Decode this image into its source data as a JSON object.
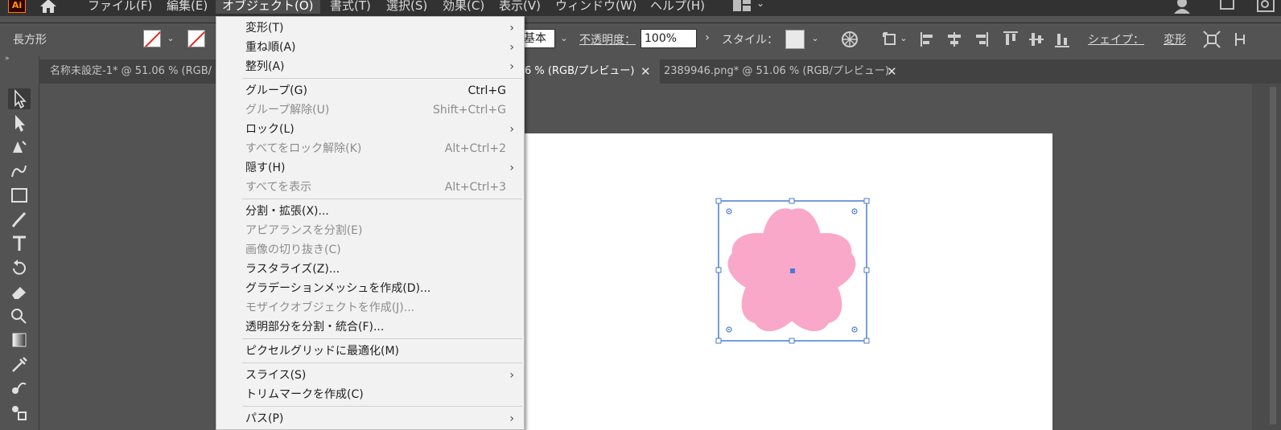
{
  "app": {
    "logo": "Ai"
  },
  "menubar": {
    "items": [
      "ファイル(F)",
      "編集(E)",
      "オブジェクト(O)",
      "書式(T)",
      "選択(S)",
      "効果(C)",
      "表示(V)",
      "ウィンドウ(W)",
      "ヘルプ(H)"
    ],
    "active_index": 2
  },
  "control_bar": {
    "tool_label": "長方形",
    "stroke_style": "基本",
    "opacity_label": "不透明度：",
    "opacity_value": "100%",
    "style_label": "スタイル：",
    "shape_label": "シェイプ：",
    "transform_label": "変形"
  },
  "tabs": [
    {
      "label": "名称未設定-1* @ 51.06 % (RGB/",
      "closable": false
    },
    {
      "label": "6 % (RGB/プレビュー)",
      "closable": true,
      "active": true
    },
    {
      "label": "2389946.png* @ 51.06 % (RGB/プレビュー)",
      "closable": true
    }
  ],
  "tab_close_glyph": "✕",
  "menu": {
    "items": [
      {
        "label": "変形(T)",
        "submenu": true,
        "enabled": true
      },
      {
        "label": "重ね順(A)",
        "submenu": true,
        "enabled": true
      },
      {
        "label": "整列(A)",
        "submenu": true,
        "enabled": true
      },
      {
        "separator": true
      },
      {
        "label": "グループ(G)",
        "shortcut": "Ctrl+G",
        "enabled": true
      },
      {
        "label": "グループ解除(U)",
        "shortcut": "Shift+Ctrl+G",
        "enabled": false
      },
      {
        "label": "ロック(L)",
        "submenu": true,
        "enabled": true
      },
      {
        "label": "すべてをロック解除(K)",
        "shortcut": "Alt+Ctrl+2",
        "enabled": false
      },
      {
        "label": "隠す(H)",
        "submenu": true,
        "enabled": true
      },
      {
        "label": "すべてを表示",
        "shortcut": "Alt+Ctrl+3",
        "enabled": false
      },
      {
        "separator": true
      },
      {
        "label": "分割・拡張(X)...",
        "enabled": true
      },
      {
        "label": "アピアランスを分割(E)",
        "enabled": false
      },
      {
        "label": "画像の切り抜き(C)",
        "enabled": false
      },
      {
        "label": "ラスタライズ(Z)...",
        "enabled": true
      },
      {
        "label": "グラデーションメッシュを作成(D)...",
        "enabled": true
      },
      {
        "label": "モザイクオブジェクトを作成(J)...",
        "enabled": false
      },
      {
        "label": "透明部分を分割・統合(F)...",
        "enabled": true
      },
      {
        "separator": true
      },
      {
        "label": "ピクセルグリッドに最適化(M)",
        "enabled": true
      },
      {
        "separator": true
      },
      {
        "label": "スライス(S)",
        "submenu": true,
        "enabled": true
      },
      {
        "label": "トリムマークを作成(C)",
        "enabled": true
      },
      {
        "separator": true
      },
      {
        "label": "パス(P)",
        "submenu": true,
        "enabled": true
      }
    ],
    "submenu_glyph": "›"
  },
  "colors": {
    "flower": "#f9a8c9",
    "selection": "#4a7bd0",
    "canvas_bg": "#535353",
    "menu_bg": "#f2f2f2"
  },
  "icons": [
    "home-icon",
    "selection-tool-icon",
    "direct-selection-tool-icon",
    "pen-tool-icon",
    "curvature-tool-icon",
    "rectangle-tool-icon",
    "paintbrush-tool-icon",
    "type-tool-icon",
    "rotate-tool-icon",
    "eraser-tool-icon",
    "shape-builder-tool-icon",
    "gradient-tool-icon",
    "eyedropper-tool-icon",
    "blend-tool-icon",
    "symbol-sprayer-tool-icon"
  ]
}
